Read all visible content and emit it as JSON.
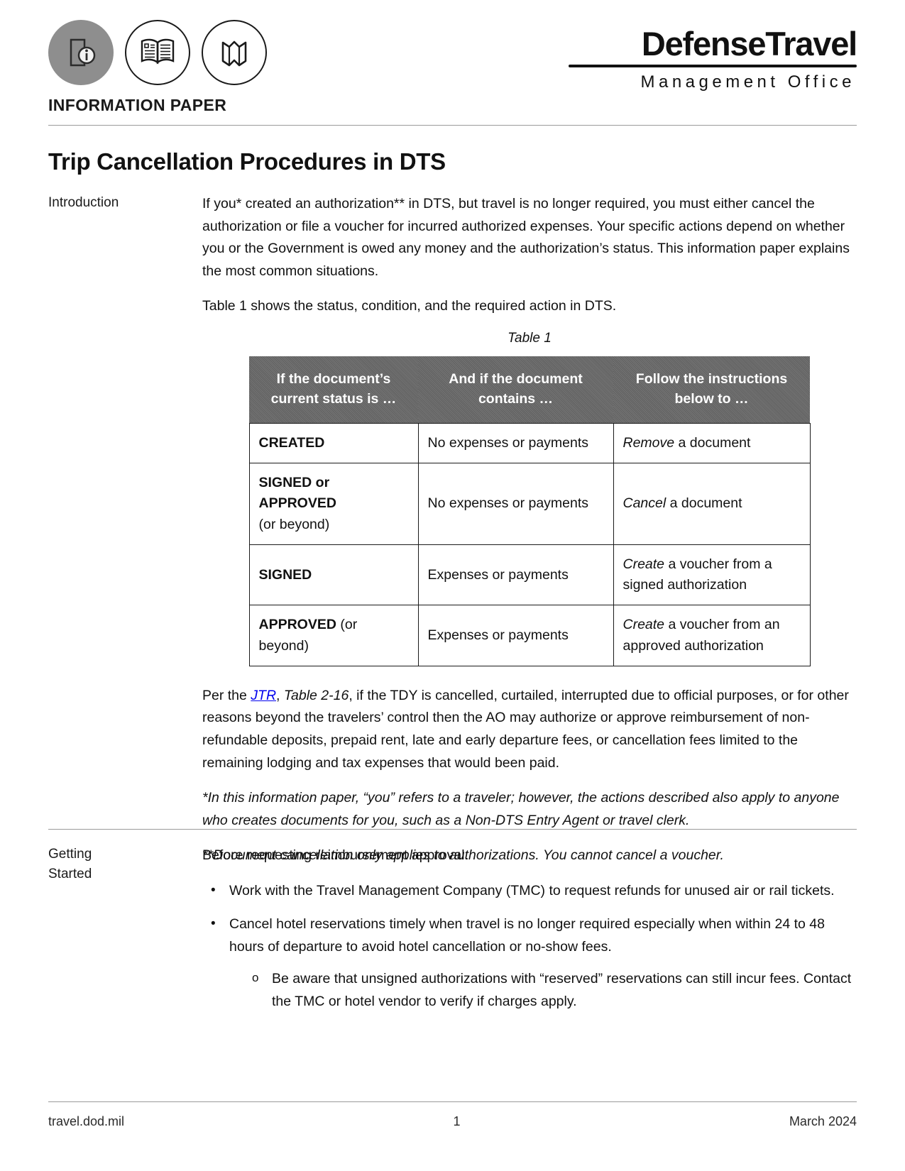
{
  "header": {
    "icons": [
      "info-circle-icon",
      "open-book-icon",
      "map-fold-icon"
    ],
    "document_kind": "INFORMATION PAPER",
    "brand_main": "DefenseTravel",
    "brand_sub": "Management Office"
  },
  "title": "Trip Cancellation Procedures in DTS",
  "sections": {
    "introduction": {
      "label": "Introduction",
      "paragraph_1": "If you* created an authorization** in DTS, but travel is no longer required, you must either cancel the authorization or file a voucher for incurred authorized expenses. Your specific actions depend on whether you or the Government is owed any money and the authorization’s status. This information paper explains the most common situations.",
      "paragraph_2": "Table 1 shows the status, condition, and the required action in DTS.",
      "table_caption": "Table 1",
      "after_table": {
        "per_the": "Per the ",
        "jtr_link": "JTR",
        "table_ref": "Table 2-16",
        "rest": ", if the TDY is cancelled, curtailed, interrupted due to official purposes, or for other reasons beyond the travelers’ control then the AO may authorize or approve reimbursement of non-refundable deposits, prepaid rent, late and early departure fees, or cancellation fees limited to the remaining lodging and tax expenses that would been paid."
      },
      "footnote_1": "*In this information paper, “you” refers to a traveler; however, the actions described also apply to anyone who creates documents for you, such as a Non-DTS Entry Agent or travel clerk.",
      "footnote_2": "**Document cancellation only applies to authorizations. You cannot cancel a voucher."
    },
    "getting_started": {
      "label_line_1": "Getting",
      "label_line_2": "Started",
      "lead": "Before requesting reimbursement approval:",
      "bullets": [
        "Work with the Travel Management Company (TMC) to request refunds for unused air or rail tickets.",
        "Cancel hotel reservations timely when travel is no longer required especially when within 24 to 48 hours of departure to avoid hotel cancellation or no-show fees."
      ],
      "sub_bullets": [
        "Be aware that unsigned authorizations with “reserved” reservations can still incur fees. Contact the TMC or hotel vendor to verify if charges apply."
      ],
      "bullet_marker": "•",
      "sub_bullet_marker": "o"
    }
  },
  "table_1": {
    "headers": [
      "If the document’s current status is …",
      "And if the document contains …",
      "Follow the instructions below to …"
    ],
    "rows": [
      {
        "status_bold": "CREATED",
        "status_normal": "",
        "contains": "No expenses or payments",
        "action_italic": "Remove",
        "action_rest": " a document"
      },
      {
        "status_bold": "SIGNED or APPROVED",
        "status_normal": "(or beyond)",
        "contains": "No expenses or payments",
        "action_italic": "Cancel",
        "action_rest": " a document"
      },
      {
        "status_bold": "SIGNED",
        "status_normal": "",
        "contains": "Expenses or payments",
        "action_italic": "Create",
        "action_rest": " a voucher from a signed authorization"
      },
      {
        "status_bold": "APPROVED",
        "status_normal": " (or beyond)",
        "contains": "Expenses or payments",
        "action_italic": "Create",
        "action_rest": " a voucher from an approved authorization"
      }
    ]
  },
  "footer": {
    "site": "travel.dod.mil",
    "page_number": "1",
    "date": "March 2024"
  },
  "colors": {
    "table_header_bg": "#5f5f5f",
    "text": "#111111",
    "rule": "#9a9a9a"
  }
}
